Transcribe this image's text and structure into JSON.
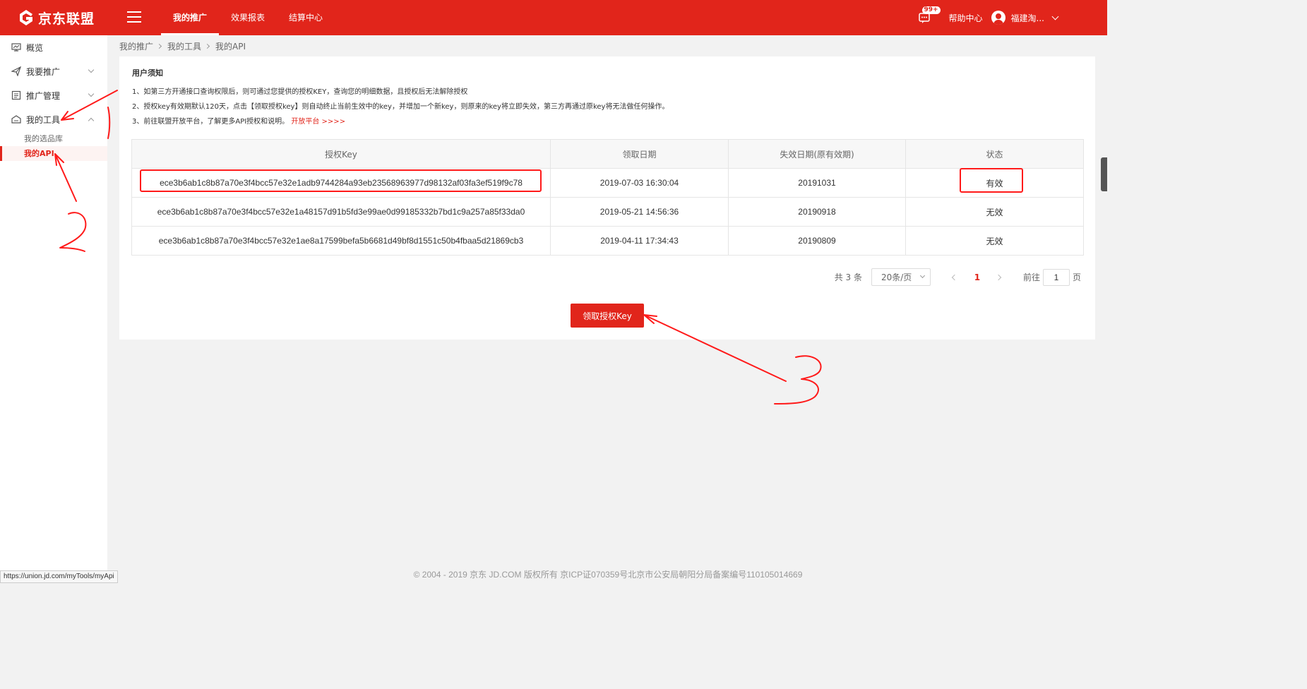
{
  "brand": {
    "name": "京东联盟",
    "color": "#e1251b"
  },
  "nav": {
    "items": [
      {
        "label": "我的推广",
        "active": true
      },
      {
        "label": "效果报表",
        "active": false
      },
      {
        "label": "结算中心",
        "active": false
      }
    ]
  },
  "header": {
    "message_badge": "99+",
    "help_label": "帮助中心",
    "user_name": "福建淘..."
  },
  "sidebar": {
    "items": [
      {
        "label": "概览",
        "icon": "monitor-icon"
      },
      {
        "label": "我要推广",
        "icon": "paper-plane-icon"
      },
      {
        "label": "推广管理",
        "icon": "list-icon"
      },
      {
        "label": "我的工具",
        "icon": "toolbox-icon"
      }
    ],
    "sub_items": [
      {
        "label": "我的选品库",
        "active": false
      },
      {
        "label": "我的API",
        "active": true
      }
    ]
  },
  "breadcrumb": [
    "我的推广",
    "我的工具",
    "我的API"
  ],
  "notice": {
    "title": "用户须知",
    "line1": "1、如第三方开通接口查询权限后，则可通过您提供的授权KEY，查询您的明细数据，且授权后无法解除授权",
    "line2": "2、授权key有效期默认120天，点击【领取授权key】则自动终止当前生效中的key，并增加一个新key，则原来的key将立即失效，第三方再通过原key将无法做任何操作。",
    "line3_prefix": "3、前往联盟开放平台，了解更多API授权和说明。",
    "line3_link": "开放平台 >>>>"
  },
  "table": {
    "headers": [
      "授权Key",
      "领取日期",
      "失效日期(原有效期)",
      "状态"
    ],
    "rows": [
      {
        "key": "ece3b6ab1c8b87a70e3f4bcc57e32e1adb9744284a93eb23568963977d98132af03fa3ef519f9c78",
        "date": "2019-07-03 16:30:04",
        "expiry": "20191031",
        "status": "有效"
      },
      {
        "key": "ece3b6ab1c8b87a70e3f4bcc57e32e1a48157d91b5fd3e99ae0d99185332b7bd1c9a257a85f33da0",
        "date": "2019-05-21 14:56:36",
        "expiry": "20190918",
        "status": "无效"
      },
      {
        "key": "ece3b6ab1c8b87a70e3f4bcc57e32e1ae8a17599befa5b6681d49bf8d1551c50b4fbaa5d21869cb3",
        "date": "2019-04-11 17:34:43",
        "expiry": "20190809",
        "status": "无效"
      }
    ]
  },
  "pagination": {
    "total": "共 3 条",
    "page_size": "20条/页",
    "current_page": "1",
    "goto_label": "前往",
    "goto_value": "1",
    "page_unit": "页"
  },
  "action_button": "领取授权Key",
  "footer": "© 2004 - 2019 京东 JD.COM 版权所有 京ICP证070359号北京市公安局朝阳分局备案编号110105014669",
  "status_url": "https://union.jd.com/myTools/myApi",
  "annotations": {
    "marks": [
      "1",
      "2",
      "3"
    ],
    "color": "#ff1a1a"
  }
}
